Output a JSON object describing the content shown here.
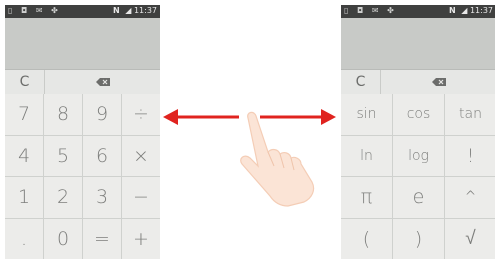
{
  "left_screen": {
    "status": {
      "left_icons": "▯ ◘ ✉ ✤",
      "nfc": "N",
      "signal": "◢",
      "time": "11:37"
    },
    "clear_label": "C",
    "keys": [
      "7",
      "8",
      "9",
      "÷",
      "4",
      "5",
      "6",
      "×",
      "1",
      "2",
      "3",
      "−",
      ".",
      "0",
      "=",
      "+"
    ]
  },
  "right_screen": {
    "status": {
      "left_icons": "▯ ◘ ✉ ✤",
      "nfc": "N",
      "signal": "◢",
      "time": "11:37"
    },
    "clear_label": "C",
    "keys": [
      "sin",
      "cos",
      "tan",
      "ln",
      "log",
      "!",
      "π",
      "e",
      "^",
      "(",
      ")",
      "√"
    ]
  },
  "icons": {
    "backspace": "backspace-icon",
    "swipe": "swipe-hand-icon",
    "arrows": "double-arrow-icon"
  },
  "colors": {
    "arrow": "#e0231f",
    "status_bar": "#3f403f",
    "display": "#c8cac7",
    "key": "#ececea",
    "key_text": "#7d7e7c"
  }
}
